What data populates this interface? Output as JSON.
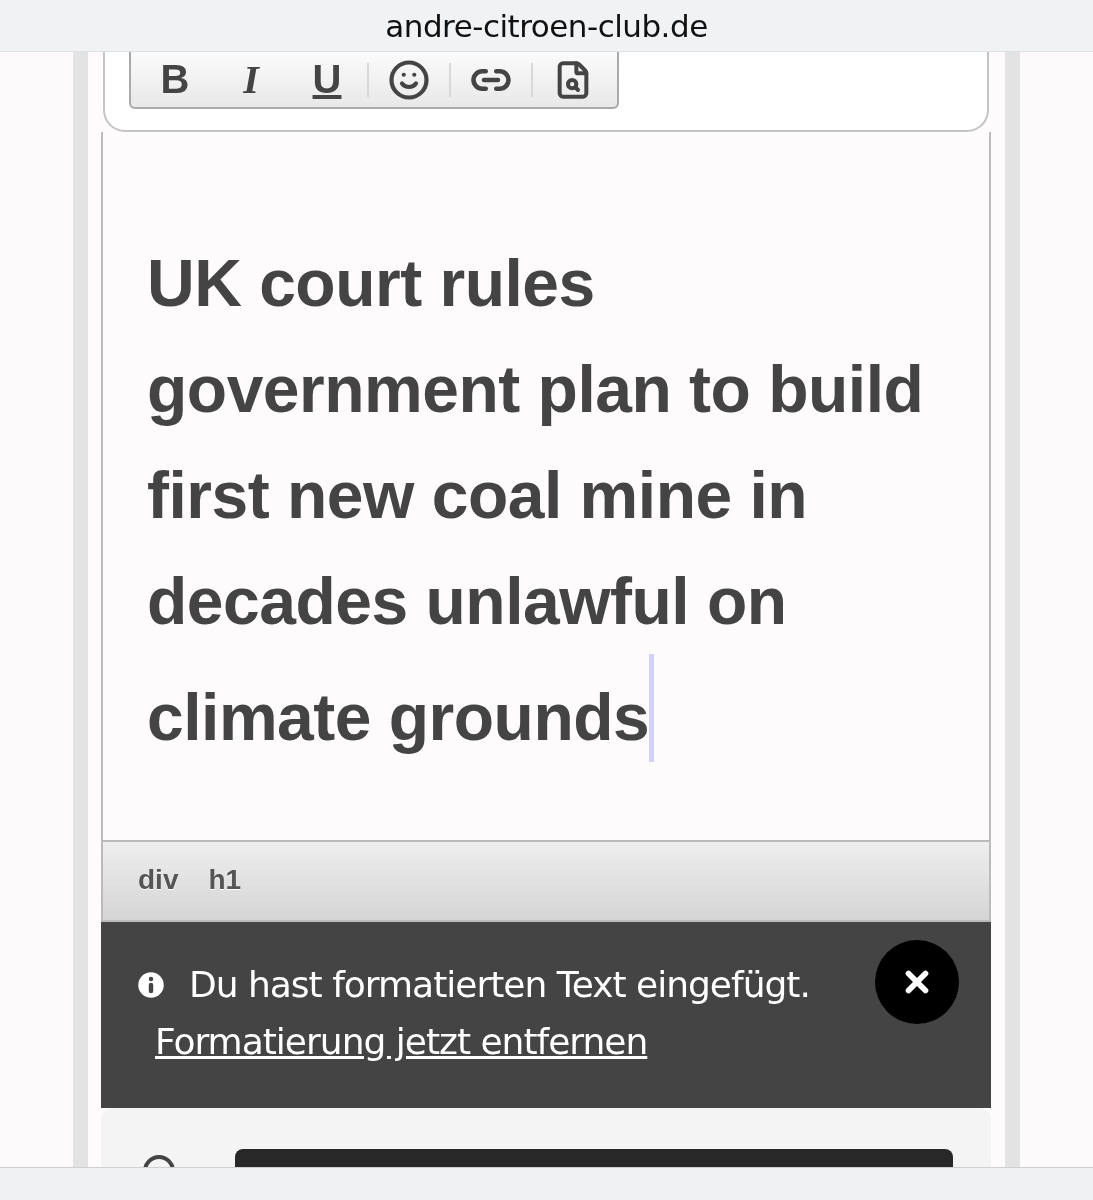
{
  "address_bar": {
    "url": "andre-citroen-club.de"
  },
  "toolbar": {
    "groups": [
      {
        "buttons": [
          {
            "kind": "bold",
            "label": "B"
          },
          {
            "kind": "italic",
            "label": "I"
          },
          {
            "kind": "underline",
            "label": "U"
          }
        ]
      },
      {
        "buttons": [
          {
            "kind": "emoji"
          }
        ]
      },
      {
        "buttons": [
          {
            "kind": "link"
          }
        ]
      },
      {
        "buttons": [
          {
            "kind": "preview"
          }
        ]
      }
    ]
  },
  "editor": {
    "heading": "UK court rules government plan to build first new coal mine in decades unlawful on climate grounds"
  },
  "path_bar": {
    "items": [
      "div",
      "h1"
    ]
  },
  "notice": {
    "message": "Du hast formatierten Text eingefügt.",
    "link": "Formatierung jetzt entfernen"
  }
}
